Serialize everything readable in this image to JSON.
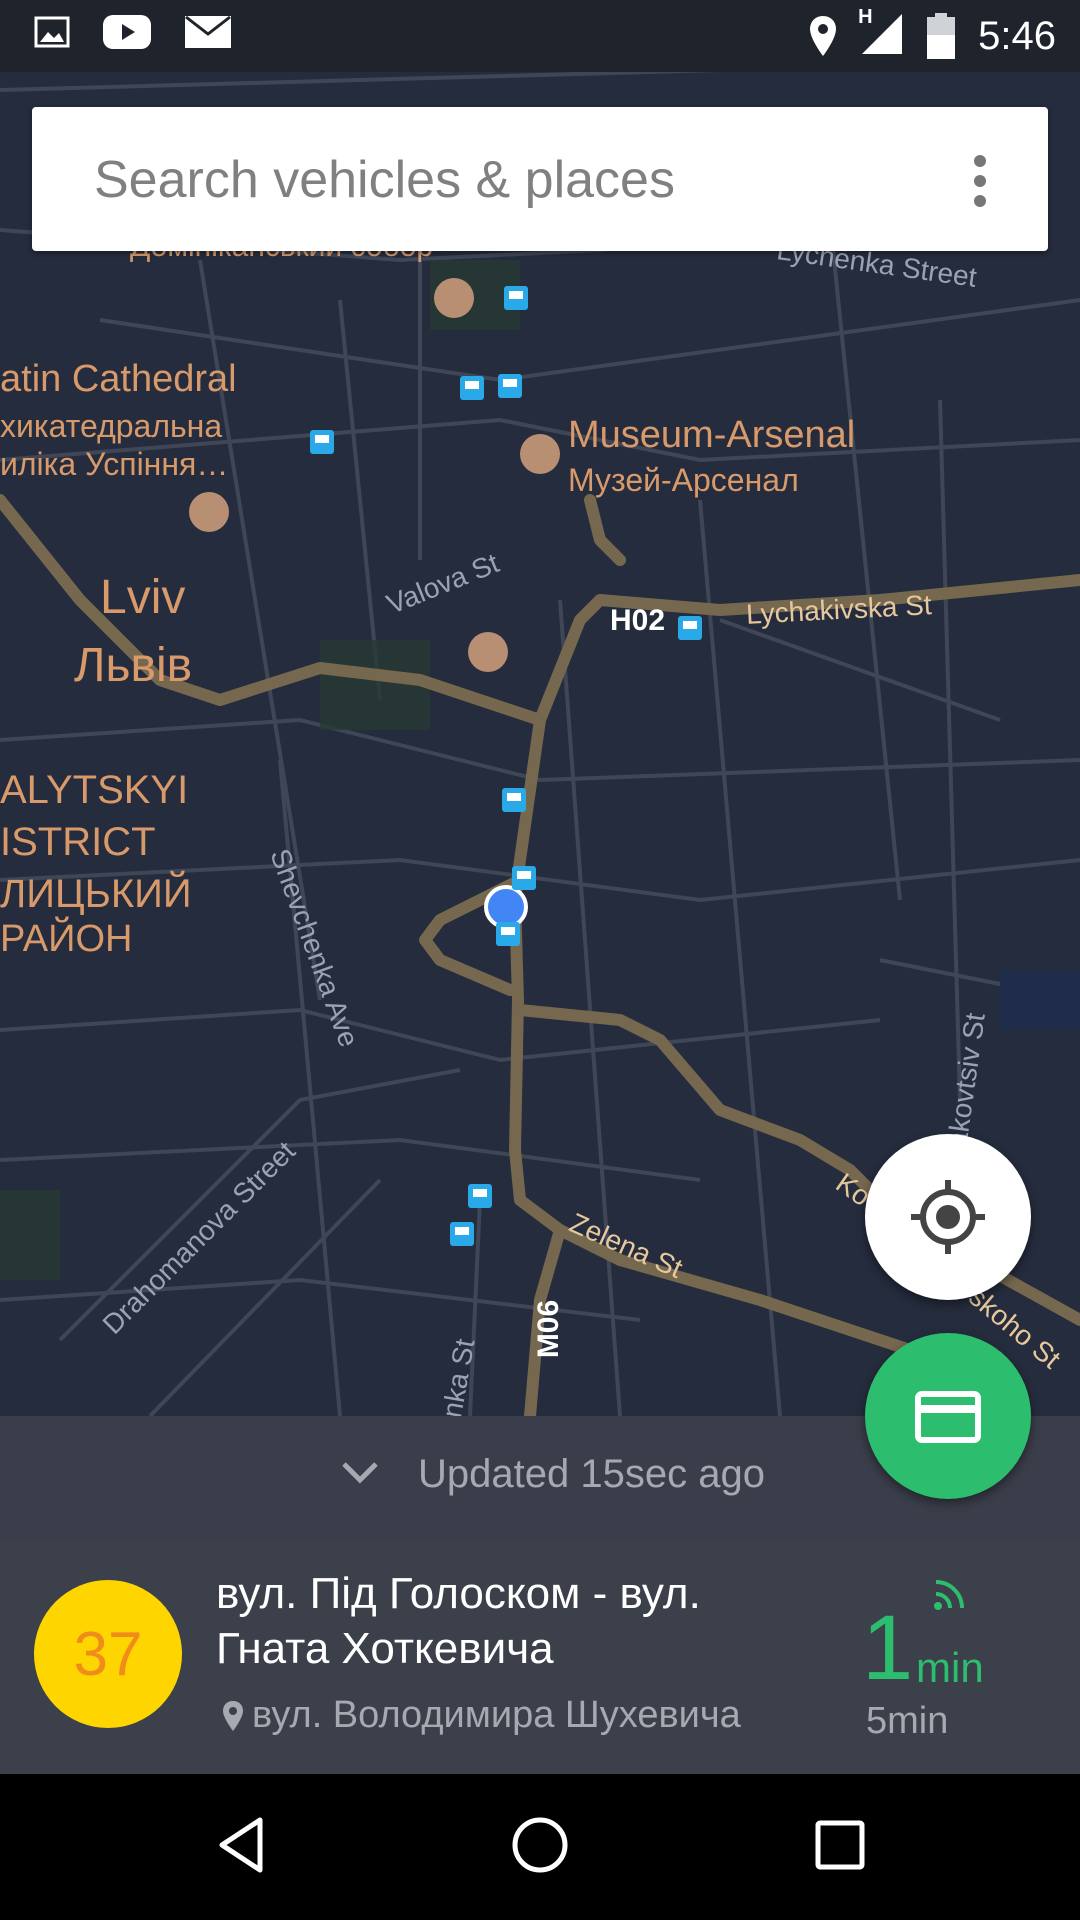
{
  "status_bar": {
    "time": "5:46",
    "network_badge": "H",
    "left_icons": [
      "image-icon",
      "youtube-icon",
      "mail-icon"
    ],
    "right_icons": [
      "location-icon",
      "signal-icon",
      "battery-icon"
    ]
  },
  "search": {
    "placeholder": "Search vehicles & places"
  },
  "map": {
    "places": [
      "Домініканський собор",
      "atin Cathedral",
      "хикатедральна",
      "иліка Успіння…",
      "Museum-Arsenal",
      "Музей-Арсенал",
      "Lviv",
      "Львів",
      "ALYTSKYI",
      "ISTRICT",
      "ЛИЦЬКИЙ",
      "РАЙОН"
    ],
    "streets": [
      "Lychenka Street",
      "Valova St",
      "Lychakivska St",
      "Shevchenka Ave",
      "Drahomanova Street",
      "Zelena St",
      "anka St",
      "nakovtsiv St",
      "Ko",
      "skoho St"
    ],
    "route_badges": [
      "H02",
      "M06"
    ],
    "colors": {
      "background": "#252c3d",
      "major_road": "#76674f",
      "minor_road": "#3f4656",
      "user_location": "#4285f4",
      "transit_stop": "#29a9e8"
    }
  },
  "fab": {
    "location_icon": "my-location-icon",
    "card_icon": "credit-card-icon",
    "card_color": "#2dbd6e"
  },
  "sheet": {
    "updated": "Updated 15sec ago",
    "route": {
      "number": "37",
      "name_line1": "вул. Під Голоском - вул.",
      "name_line2": "Гната Хоткевича",
      "stop": "вул. Володимира Шухевича",
      "eta_value": "1",
      "eta_unit": "min",
      "eta_next": "5min"
    }
  },
  "nav_bar": {
    "buttons": [
      "back-icon",
      "home-icon",
      "recents-icon"
    ]
  }
}
